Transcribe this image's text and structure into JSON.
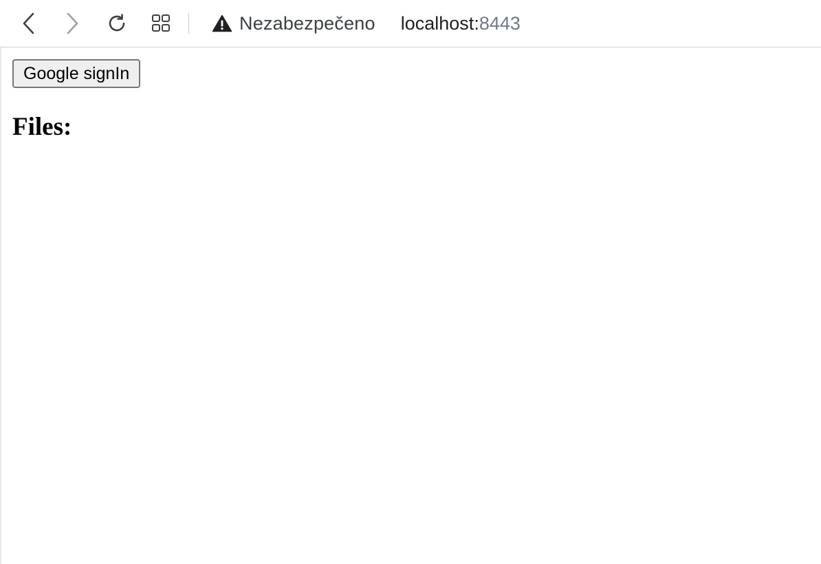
{
  "browser": {
    "security_label": "Nezabezpečeno",
    "url_host": "localhost:",
    "url_port": "8443",
    "icons": {
      "back": "chevron-left-icon",
      "forward": "chevron-right-icon",
      "reload": "reload-icon",
      "tabs": "tab-grid-icon",
      "security": "warning-triangle-icon"
    },
    "colors": {
      "icon_active": "#3c4043",
      "icon_disabled": "#9aa0a6",
      "port_text": "#6f7b86"
    }
  },
  "page": {
    "signin_label": "Google signIn",
    "files_heading": "Files:"
  }
}
